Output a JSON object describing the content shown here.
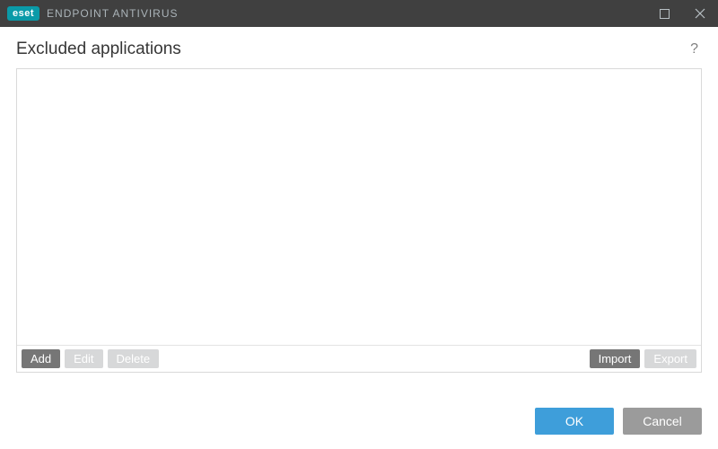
{
  "titlebar": {
    "brand_badge": "eset",
    "brand_text": "ENDPOINT ANTIVIRUS"
  },
  "header": {
    "title": "Excluded applications"
  },
  "actions": {
    "add": "Add",
    "edit": "Edit",
    "delete": "Delete",
    "import": "Import",
    "export": "Export"
  },
  "footer": {
    "ok": "OK",
    "cancel": "Cancel"
  },
  "list": {
    "items": []
  },
  "colors": {
    "titlebar_bg": "#404040",
    "brand_badge_bg": "#0a9aa8",
    "primary_btn": "#3e9eda",
    "secondary_btn": "#9b9b9b",
    "small_enabled": "#767676",
    "small_disabled": "#d7d8d9"
  }
}
